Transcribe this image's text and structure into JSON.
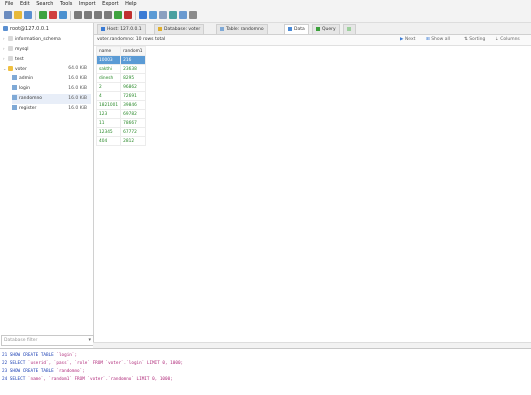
{
  "menu": [
    "File",
    "Edit",
    "Search",
    "Tools",
    "Import",
    "Export",
    "Help"
  ],
  "toolbar_icons": [
    "new-query-icon",
    "open-icon",
    "save-icon",
    "execute-icon",
    "stop-icon",
    "refresh-icon",
    "first-icon",
    "prev-icon",
    "next-icon",
    "last-icon",
    "add-row-icon",
    "delete-row-icon",
    "commit-icon",
    "rollback-icon",
    "filter-icon",
    "export-icon",
    "settings-icon",
    "help-icon"
  ],
  "sidebar": {
    "connection": "root@127.0.0.1",
    "databases": [
      {
        "name": "information_schema",
        "size": ""
      },
      {
        "name": "mysql",
        "size": ""
      },
      {
        "name": "test",
        "size": ""
      },
      {
        "name": "voter",
        "size": "64.0 KiB"
      }
    ],
    "tables": [
      {
        "name": "admin",
        "size": "16.0 KiB"
      },
      {
        "name": "login",
        "size": "16.0 KiB"
      },
      {
        "name": "randomno",
        "size": "16.0 KiB"
      },
      {
        "name": "register",
        "size": "16.0 KiB"
      }
    ],
    "filter_placeholder": "Database filter"
  },
  "tabs": [
    {
      "label": "Host: 127.0.0.1",
      "color": "#3a7bd5"
    },
    {
      "label": "Database: voter",
      "color": "#e0b030"
    },
    {
      "label": "Table: randomno",
      "color": "#7fa9d6"
    },
    {
      "label": "Data",
      "color": "#4a8ad6"
    },
    {
      "label": "Query",
      "color": "#3aa03a"
    }
  ],
  "info": {
    "summary": "voter.randomno: 10 rows total",
    "next": "Next",
    "show_all": "Show all",
    "sorting": "Sorting",
    "columns": "Columns"
  },
  "grid": {
    "columns": [
      "name",
      "random1"
    ],
    "rows": [
      [
        "10003",
        "216"
      ],
      [
        "sakthi",
        "23638"
      ],
      [
        "dinesh",
        "8295"
      ],
      [
        "2",
        "96862"
      ],
      [
        "4",
        "72691"
      ],
      [
        "1821001",
        "39846"
      ],
      [
        "123",
        "69782"
      ],
      [
        "11",
        "78667"
      ],
      [
        "12345",
        "67772"
      ],
      [
        "404",
        "2812"
      ]
    ]
  },
  "console": [
    {
      "n": "21",
      "kw": "SHOW CREATE TABLE",
      "rest": " `login`;"
    },
    {
      "n": "22",
      "kw": "SELECT",
      "rest": " `userid`, `pass`, `role` FROM `voter`.`login` LIMIT 0, 1000;"
    },
    {
      "n": "23",
      "kw": "SHOW CREATE TABLE",
      "rest": " `randomno`;"
    },
    {
      "n": "24",
      "kw": "SELECT",
      "rest": " `name`, `random1` FROM `voter`.`randomno` LIMIT 0, 1000;"
    }
  ]
}
